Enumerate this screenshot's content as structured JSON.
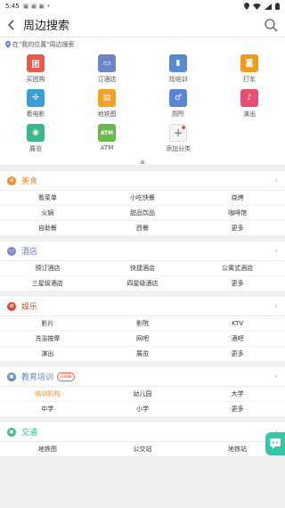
{
  "status": {
    "time": "5:45",
    "glyphs": "▣ ▣ ▣ •"
  },
  "header": {
    "title": "周边搜索"
  },
  "location": {
    "text": "在\"我的位置\"周边搜索"
  },
  "grid": [
    {
      "label": "买团购",
      "icon": "coupon-icon",
      "color": "#e45b4a",
      "glyph": "团"
    },
    {
      "label": "订酒店",
      "icon": "bed-icon",
      "color": "#6a86c8",
      "glyph": "▭"
    },
    {
      "label": "找培训",
      "icon": "book-icon",
      "color": "#5a8ad6",
      "glyph": "▮"
    },
    {
      "label": "打车",
      "icon": "car-icon",
      "color": "#f29a1c",
      "glyph": "◙"
    },
    {
      "label": "看电影",
      "icon": "film-icon",
      "color": "#3b9ed6",
      "glyph": "✣"
    },
    {
      "label": "地铁图",
      "icon": "subway-icon",
      "color": "#f2a12a",
      "glyph": "▤"
    },
    {
      "label": "厕所",
      "icon": "toilet-icon",
      "color": "#5a84d6",
      "glyph": "♂"
    },
    {
      "label": "演出",
      "icon": "music-icon",
      "color": "#e5506e",
      "glyph": "♪"
    },
    {
      "label": "展览",
      "icon": "eye-icon",
      "color": "#3ab88a",
      "glyph": "◉"
    },
    {
      "label": "ATM",
      "icon": "atm-icon",
      "color": "#6ab84a",
      "glyph": "ATM"
    },
    {
      "label": "添加分类",
      "icon": "add-icon",
      "color": "#f4f4f4",
      "glyph": "+"
    }
  ],
  "sections": [
    {
      "title": "美食",
      "icon": "food-icon",
      "color": "#f08a24",
      "glyph": "⊕",
      "new": "",
      "items": [
        "看菜单",
        "小吃快餐",
        "烧烤",
        "火锅",
        "甜品饮品",
        "咖啡馆",
        "自助餐",
        "西餐",
        "更多"
      ]
    },
    {
      "title": "酒店",
      "icon": "hotel-icon",
      "color": "#7a88d6",
      "glyph": "▭",
      "new": "",
      "items": [
        "预订酒店",
        "快捷酒店",
        "公寓式酒店",
        "三星级酒店",
        "四星级酒店",
        "更多"
      ]
    },
    {
      "title": "娱乐",
      "icon": "fun-icon",
      "color": "#e0442a",
      "glyph": "✿",
      "new": "",
      "items": [
        "影片",
        "影院",
        "KTV",
        "洗浴按摩",
        "网吧",
        "酒吧",
        "演出",
        "展览",
        "更多"
      ]
    },
    {
      "title": "教育培训",
      "icon": "education-icon",
      "color": "#6a86c8",
      "glyph": "▣",
      "new": "new",
      "items": [
        "培训机构",
        "幼儿园",
        "大学",
        "中学",
        "小学",
        "更多"
      ]
    },
    {
      "title": "交通",
      "icon": "transport-icon",
      "color": "#3ab88a",
      "glyph": "▣",
      "new": "",
      "items": [
        "地铁图",
        "公交站",
        "地铁站"
      ]
    }
  ]
}
